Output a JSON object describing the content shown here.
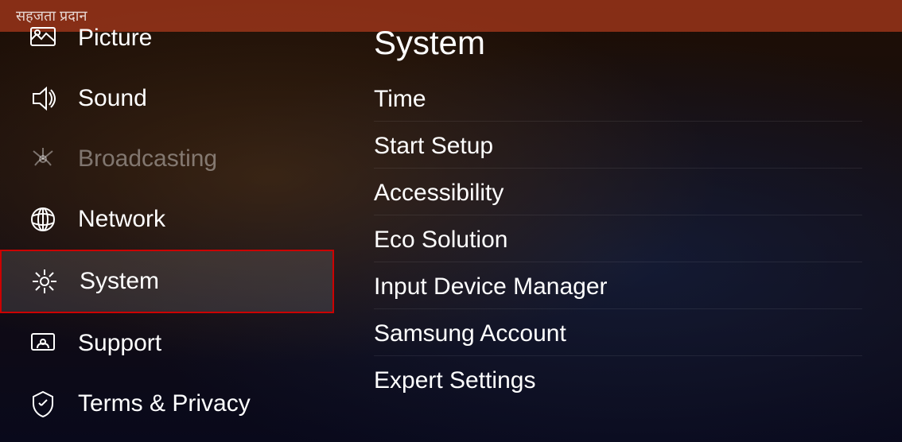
{
  "header": {
    "text": "सहजता प्रदान"
  },
  "sidebar": {
    "items": [
      {
        "id": "picture",
        "label": "Picture",
        "icon": "picture-icon",
        "active": false,
        "dimmed": false
      },
      {
        "id": "sound",
        "label": "Sound",
        "icon": "sound-icon",
        "active": false,
        "dimmed": false
      },
      {
        "id": "broadcasting",
        "label": "Broadcasting",
        "icon": "broadcasting-icon",
        "active": false,
        "dimmed": true
      },
      {
        "id": "network",
        "label": "Network",
        "icon": "network-icon",
        "active": false,
        "dimmed": false
      },
      {
        "id": "system",
        "label": "System",
        "icon": "system-icon",
        "active": true,
        "dimmed": false
      },
      {
        "id": "support",
        "label": "Support",
        "icon": "support-icon",
        "active": false,
        "dimmed": false
      },
      {
        "id": "terms",
        "label": "Terms & Privacy",
        "icon": "terms-icon",
        "active": false,
        "dimmed": false
      }
    ]
  },
  "rightPanel": {
    "title": "System",
    "menuItems": [
      {
        "id": "time",
        "label": "Time"
      },
      {
        "id": "start-setup",
        "label": "Start Setup"
      },
      {
        "id": "accessibility",
        "label": "Accessibility"
      },
      {
        "id": "eco-solution",
        "label": "Eco Solution"
      },
      {
        "id": "input-device-manager",
        "label": "Input Device Manager"
      },
      {
        "id": "samsung-account",
        "label": "Samsung Account"
      },
      {
        "id": "expert-settings",
        "label": "Expert Settings"
      }
    ]
  }
}
